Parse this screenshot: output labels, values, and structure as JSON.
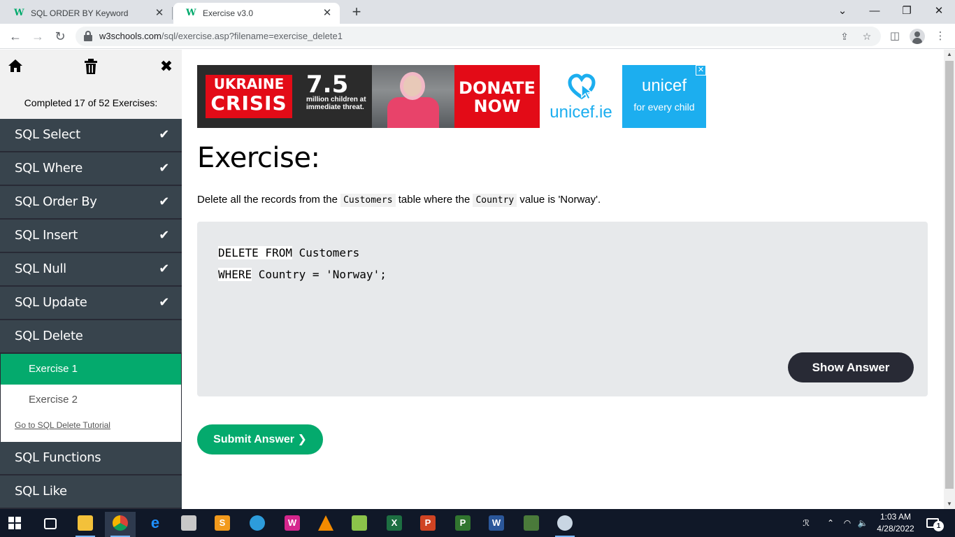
{
  "browser": {
    "tabs": [
      {
        "title": "SQL ORDER BY Keyword",
        "favicon": "w3"
      },
      {
        "title": "Exercise v3.0",
        "favicon": "w3"
      }
    ],
    "url_host": "w3schools.com",
    "url_path": "/sql/exercise.asp?filename=exercise_delete1"
  },
  "sidebar": {
    "completed_text": "Completed 17 of 52 Exercises:",
    "sections": [
      {
        "label": "SQL Select",
        "done": true
      },
      {
        "label": "SQL Where",
        "done": true
      },
      {
        "label": "SQL Order By",
        "done": true
      },
      {
        "label": "SQL Insert",
        "done": true
      },
      {
        "label": "SQL Null",
        "done": true
      },
      {
        "label": "SQL Update",
        "done": true
      },
      {
        "label": "SQL Delete",
        "done": false
      },
      {
        "label": "SQL Functions",
        "done": false
      },
      {
        "label": "SQL Like",
        "done": false
      }
    ],
    "sub_items": [
      "Exercise 1",
      "Exercise 2"
    ],
    "tutorial_link": "Go to SQL Delete Tutorial"
  },
  "ad": {
    "crisis_line1": "UKRAINE",
    "crisis_line2": "CRISIS",
    "number": "7.5",
    "small_text": "million children at immediate threat.",
    "donate_line1": "DONATE",
    "donate_line2": "NOW",
    "site": "unicef.ie",
    "brand": "unicef",
    "tagline": "for every child",
    "close": "✕"
  },
  "exercise": {
    "heading": "Exercise:",
    "instr_part1": "Delete all the records from the ",
    "instr_code1": "Customers",
    "instr_part2": " table where the ",
    "instr_code2": "Country",
    "instr_part3": " value is 'Norway'.",
    "line1_kw": "DELETE FROM",
    "line1_rest": " Customers",
    "line2_kw": "WHERE",
    "line2_rest": " Country = 'Norway';",
    "show_answer": "Show Answer",
    "submit": "Submit Answer ❯"
  },
  "taskbar": {
    "time": "1:03 AM",
    "date": "4/28/2022",
    "notification_count": "1"
  },
  "colors": {
    "w3_green": "#04aa6d",
    "sidebar_dark": "#38444d",
    "code_bg": "#e7e9eb",
    "unicef_blue": "#1caeef",
    "ad_red": "#e30b17"
  }
}
